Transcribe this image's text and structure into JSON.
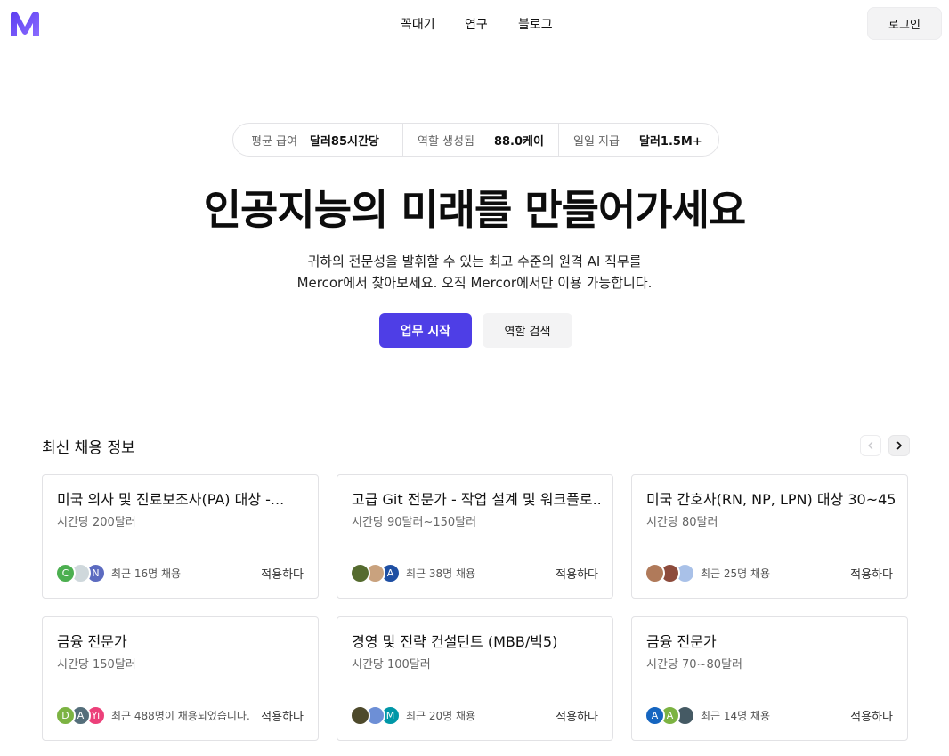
{
  "header": {
    "logo_icon": "mercor-m-logo",
    "nav": [
      "꼭대기",
      "연구",
      "블로그"
    ],
    "login_label": "로그인"
  },
  "stats": [
    {
      "label": "평균 급여",
      "value": "달러85시간당"
    },
    {
      "label": "역할 생성됨",
      "value": "88.0케이"
    },
    {
      "label": "일일 지급",
      "value": "달러1.5M+"
    }
  ],
  "hero": {
    "title": "인공지능의 미래를 만들어가세요",
    "subtitle_line1": "귀하의 전문성을 발휘할 수 있는 최고 수준의 원격 AI 직무를",
    "subtitle_line2": "Mercor에서 찾아보세요. 오직 Mercor에서만 이용 가능합니다.",
    "primary_button": "업무 시작",
    "secondary_button": "역할 검색"
  },
  "section": {
    "title": "최신 채용 정보",
    "prev_icon": "chevron-left-icon",
    "next_icon": "chevron-right-icon"
  },
  "accent_color": "#4e3ee6",
  "jobs": [
    {
      "title": "미국 의사 및 진료보조사(PA) 대상 -...",
      "rate": "시간당 200달러",
      "hires": "최근 16명 채용",
      "apply": "적용하다",
      "avatars": [
        {
          "letter": "C",
          "color": "#4caf50"
        },
        {
          "letter": "",
          "color": "#cfd8dc"
        },
        {
          "letter": "N",
          "color": "#5c6bc0"
        }
      ]
    },
    {
      "title": "고급 Git 전문가 - 작업 설계 및 워크플로...",
      "rate": "시간당 90달러~150달러",
      "hires": "최근 38명 채용",
      "apply": "적용하다",
      "avatars": [
        {
          "letter": "",
          "color": "#556b2f"
        },
        {
          "letter": "",
          "color": "#c9a27e"
        },
        {
          "letter": "A",
          "color": "#1e4fa3"
        }
      ]
    },
    {
      "title": "미국 간호사(RN, NP, LPN) 대상 30~45...",
      "rate": "시간당 80달러",
      "hires": "최근 25명 채용",
      "apply": "적용하다",
      "avatars": [
        {
          "letter": "",
          "color": "#b07a5a"
        },
        {
          "letter": "",
          "color": "#8d4b3c"
        },
        {
          "letter": "",
          "color": "#a9c1e8"
        }
      ]
    },
    {
      "title": "금융 전문가",
      "rate": "시간당 150달러",
      "hires": "최근 488명이 채용되었습니다.",
      "apply": "적용하다",
      "avatars": [
        {
          "letter": "D",
          "color": "#7cb342"
        },
        {
          "letter": "A",
          "color": "#546e7a"
        },
        {
          "letter": "Yi",
          "color": "#ec407a"
        }
      ]
    },
    {
      "title": "경영 및 전략 컨설턴트 (MBB/빅5)",
      "rate": "시간당 100달러",
      "hires": "최근 20명 채용",
      "apply": "적용하다",
      "avatars": [
        {
          "letter": "",
          "color": "#4e4a2c"
        },
        {
          "letter": "",
          "color": "#6d8fd6"
        },
        {
          "letter": "M",
          "color": "#0097a7"
        }
      ]
    },
    {
      "title": "금융 전문가",
      "rate": "시간당 70~80달러",
      "hires": "최근 14명 채용",
      "apply": "적용하다",
      "avatars": [
        {
          "letter": "A",
          "color": "#1565c0"
        },
        {
          "letter": "A",
          "color": "#7cb342"
        },
        {
          "letter": "",
          "color": "#455a64"
        }
      ]
    }
  ]
}
